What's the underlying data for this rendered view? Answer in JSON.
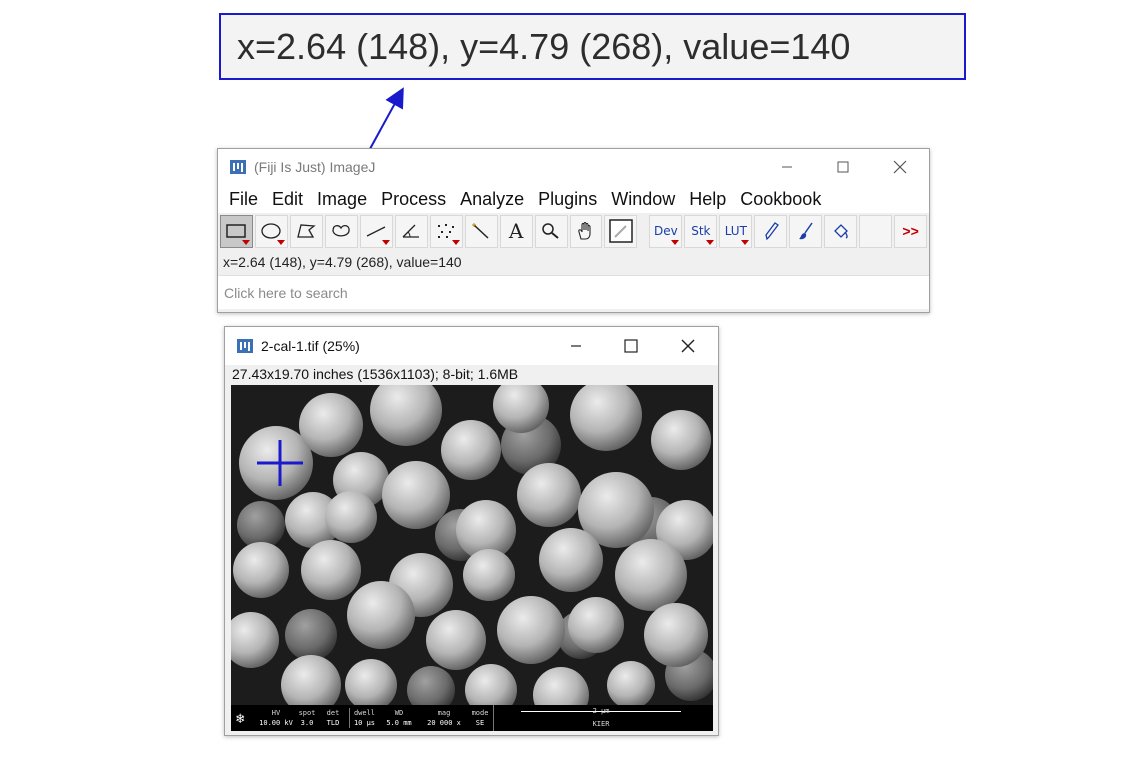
{
  "callout": {
    "text": "x=2.64 (148), y=4.79 (268), value=140",
    "border_color": "#1a1acc",
    "arrow_color": "#1a1acc"
  },
  "main_window": {
    "title": "(Fiji Is Just) ImageJ",
    "icon": "fiji-logo-icon",
    "controls": [
      "minimize-icon",
      "maximize-icon",
      "close-icon"
    ],
    "menus": [
      "File",
      "Edit",
      "Image",
      "Process",
      "Analyze",
      "Plugins",
      "Window",
      "Help",
      "Cookbook"
    ],
    "tools": [
      {
        "name": "rectangle-tool",
        "icon": "rectangle-icon",
        "active": true,
        "dropdown": true
      },
      {
        "name": "oval-tool",
        "icon": "oval-icon",
        "dropdown": true
      },
      {
        "name": "polygon-tool",
        "icon": "polygon-icon"
      },
      {
        "name": "freehand-tool",
        "icon": "freehand-icon"
      },
      {
        "name": "line-tool",
        "icon": "line-icon",
        "dropdown": true
      },
      {
        "name": "angle-tool",
        "icon": "angle-icon"
      },
      {
        "name": "point-tool",
        "icon": "multipoint-icon",
        "dropdown": true
      },
      {
        "name": "wand-tool",
        "icon": "wand-icon"
      },
      {
        "name": "text-tool",
        "icon": "text-icon",
        "label": "A"
      },
      {
        "name": "zoom-tool",
        "icon": "magnifier-icon"
      },
      {
        "name": "hand-tool",
        "icon": "hand-icon"
      },
      {
        "name": "color-picker-tool",
        "icon": "dropper-icon"
      }
    ],
    "menu_tools": [
      {
        "name": "dev-menu",
        "label": "Dev"
      },
      {
        "name": "stk-menu",
        "label": "Stk"
      },
      {
        "name": "lut-menu",
        "label": "LUT"
      }
    ],
    "extra_tools": [
      "pencil-icon",
      "brush-icon",
      "flood-fill-icon"
    ],
    "more_label": ">>",
    "status": "x=2.64 (148), y=4.79 (268), value=140",
    "search_placeholder": "Click here to search"
  },
  "image_window": {
    "title": "2-cal-1.tif (25%)",
    "icon": "fiji-logo-icon",
    "controls": [
      "minimize-icon",
      "maximize-icon",
      "close-icon"
    ],
    "info": "27.43x19.70 inches (1536x1103); 8-bit; 1.6MB",
    "crosshair_color": "#1a1acc",
    "databar": {
      "cells": [
        {
          "label": "HV",
          "value": "10.00 kV"
        },
        {
          "label": "spot",
          "value": "3.0"
        },
        {
          "label": "det",
          "value": "TLD"
        },
        {
          "label": "dwell",
          "value": "10 µs"
        },
        {
          "label": "WD",
          "value": "5.0 mm"
        },
        {
          "label": "mag",
          "value": "20 000 x"
        },
        {
          "label": "mode",
          "value": "SE"
        }
      ],
      "scale_label": "2 µm",
      "institution": "KIER"
    }
  }
}
